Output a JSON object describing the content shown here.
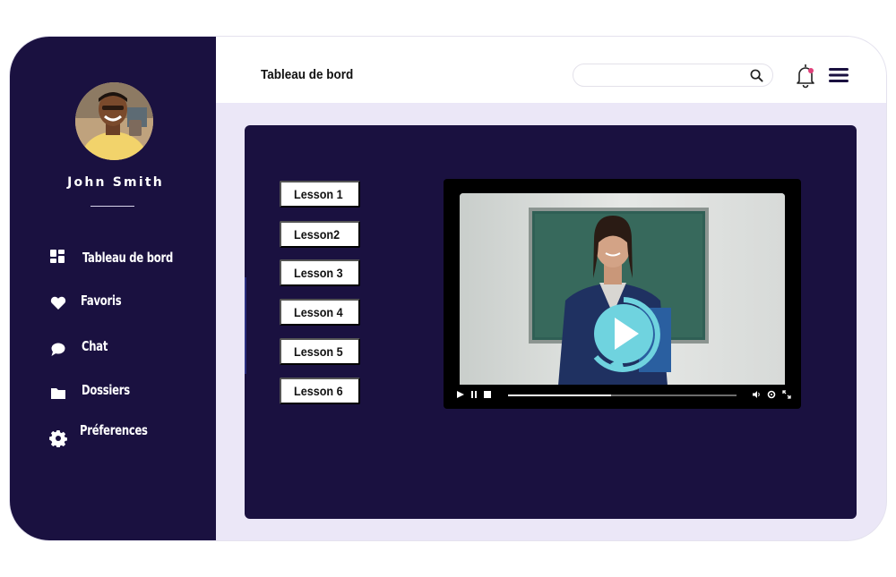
{
  "profile": {
    "name": "John Smith"
  },
  "sidebar": {
    "items": [
      {
        "label": "Tableau de bord",
        "icon": "dashboard-icon"
      },
      {
        "label": "Favoris",
        "icon": "heart-icon"
      },
      {
        "label": "Chat",
        "icon": "chat-icon"
      },
      {
        "label": "Dossiers",
        "icon": "folder-icon"
      },
      {
        "label": "Préferences",
        "icon": "gear-icon"
      }
    ]
  },
  "header": {
    "title": "Tableau de bord",
    "search": {
      "value": "",
      "placeholder": ""
    },
    "notification_dot": true
  },
  "lessons": [
    "Lesson 1",
    "Lesson2",
    "Lesson 3",
    "Lesson 4",
    "Lesson 5",
    "Lesson 6"
  ],
  "player": {
    "progress": 0.45
  },
  "colors": {
    "sidebar_bg": "#1a1140",
    "panel_bg": "#1a1140",
    "page_bg": "#ebe7f7",
    "play_accent": "#6fd3df",
    "notification": "#e0407a"
  }
}
